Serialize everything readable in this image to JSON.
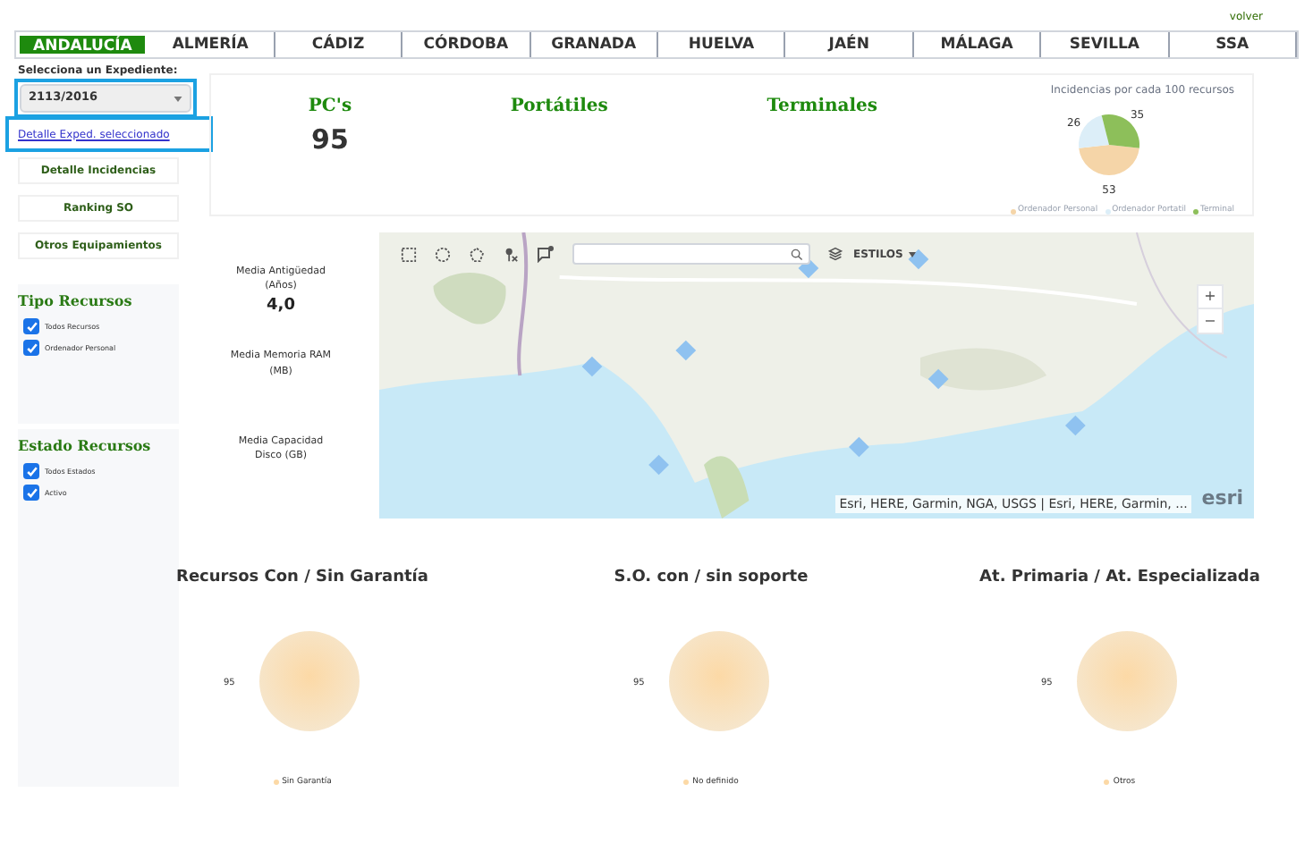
{
  "header": {
    "back_link": "volver"
  },
  "tabs": [
    {
      "label": "ANDALUCÍA",
      "selected": true
    },
    {
      "label": "ALMERÍA",
      "selected": false
    },
    {
      "label": "CÁDIZ",
      "selected": false
    },
    {
      "label": "CÓRDOBA",
      "selected": false
    },
    {
      "label": "GRANADA",
      "selected": false
    },
    {
      "label": "HUELVA",
      "selected": false
    },
    {
      "label": "JAÉN",
      "selected": false
    },
    {
      "label": "MÁLAGA",
      "selected": false
    },
    {
      "label": "SEVILLA",
      "selected": false
    },
    {
      "label": "SSA",
      "selected": false
    }
  ],
  "sidebar": {
    "select_label": "Selecciona un Expediente:",
    "select_value": "2113/2016",
    "detail_link": "Detalle Exped. seleccionado",
    "buttons": [
      "Detalle Incidencias",
      "Ranking SO",
      "Otros Equipamientos"
    ],
    "filters": [
      {
        "title": "Tipo Recursos",
        "options": [
          {
            "label": "Todos Recursos",
            "checked": true
          },
          {
            "label": "Ordenador Personal",
            "checked": true
          }
        ]
      },
      {
        "title": "Estado Recursos",
        "options": [
          {
            "label": "Todos Estados",
            "checked": true
          },
          {
            "label": "Activo",
            "checked": true
          }
        ]
      }
    ]
  },
  "summary": {
    "counters": [
      {
        "label": "PC's",
        "value": "95"
      },
      {
        "label": "Portátiles"
      },
      {
        "label": "Terminales"
      }
    ],
    "chart_data": {
      "type": "pie",
      "title": "Incidencias por cada 100 recursos",
      "categories": [
        "Ordenador Personal",
        "Ordenador Portatil",
        "Terminal"
      ],
      "values": [
        53,
        26,
        35
      ],
      "colors": [
        "#f5d5a8",
        "#dceef8",
        "#8dbf5a"
      ],
      "data_labels": true
    }
  },
  "stats": [
    {
      "label": "Media Antigüedad (Años)",
      "value": "4,0"
    },
    {
      "label": "Media Memoria RAM (MB)"
    },
    {
      "label": "Media Capacidad Disco (GB)"
    }
  ],
  "map": {
    "styles_button": "ESTILOS",
    "zoom_in": "+",
    "zoom_out": "−",
    "attribution": "Esri, HERE, Garmin, NGA, USGS | Esri, HERE, Garmin, ...",
    "logo": "esri"
  },
  "charts": [
    {
      "title": "Recursos Con / Sin Garantía",
      "chart_data": {
        "type": "pie",
        "categories": [
          "Sin Garantía"
        ],
        "values": [
          95
        ],
        "colors": [
          "#fcd9a6"
        ],
        "data_labels": true
      }
    },
    {
      "title": "S.O. con / sin soporte",
      "chart_data": {
        "type": "pie",
        "categories": [
          "No definido"
        ],
        "values": [
          95
        ],
        "colors": [
          "#fcd9a6"
        ],
        "data_labels": true
      }
    },
    {
      "title": "At. Primaria / At. Especializada",
      "chart_data": {
        "type": "pie",
        "categories": [
          "Otros"
        ],
        "values": [
          95
        ],
        "colors": [
          "#fcd9a6"
        ],
        "data_labels": true
      }
    }
  ]
}
